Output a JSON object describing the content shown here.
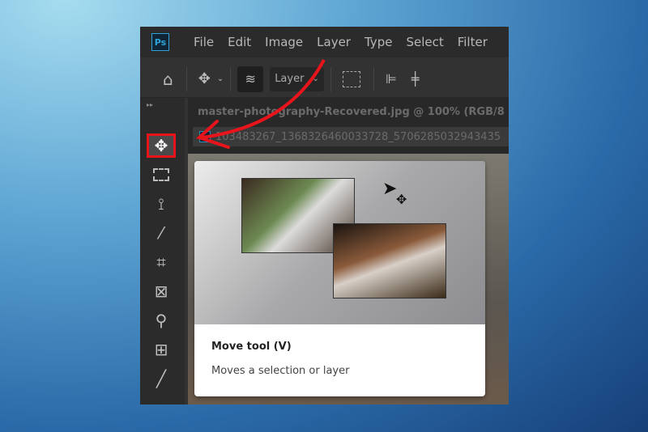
{
  "app": {
    "logo": "Ps"
  },
  "menu": [
    "File",
    "Edit",
    "Image",
    "Layer",
    "Type",
    "Select",
    "Filter"
  ],
  "options": {
    "auto_select_target": "Layer"
  },
  "document": {
    "title": "master-photography-Recovered.jpg @ 100% (RGB/8",
    "second_tab": "103483267_1368326460033728_5706285032943435"
  },
  "tooltip": {
    "title": "Move tool (V)",
    "description": "Moves a selection or layer"
  },
  "colors": {
    "highlight": "#e8141c",
    "arrow": "#e8141c"
  }
}
